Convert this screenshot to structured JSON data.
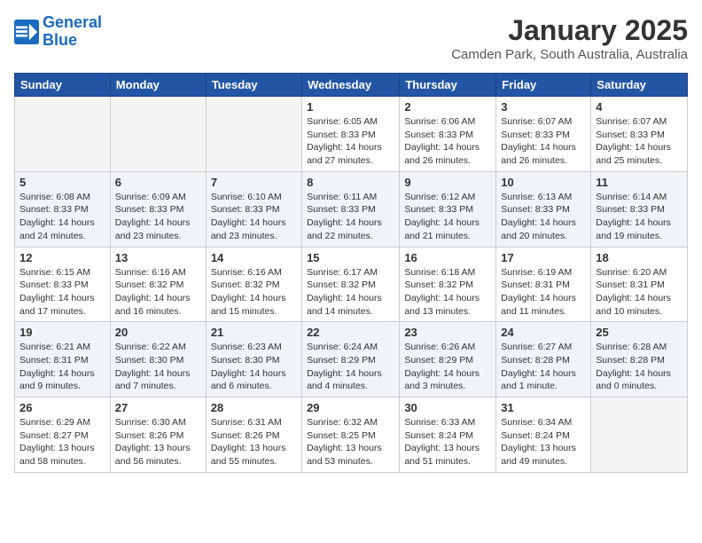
{
  "logo": {
    "line1": "General",
    "line2": "Blue"
  },
  "title": "January 2025",
  "location": "Camden Park, South Australia, Australia",
  "days_of_week": [
    "Sunday",
    "Monday",
    "Tuesday",
    "Wednesday",
    "Thursday",
    "Friday",
    "Saturday"
  ],
  "weeks": [
    [
      {
        "day": "",
        "info": ""
      },
      {
        "day": "",
        "info": ""
      },
      {
        "day": "",
        "info": ""
      },
      {
        "day": "1",
        "info": "Sunrise: 6:05 AM\nSunset: 8:33 PM\nDaylight: 14 hours\nand 27 minutes."
      },
      {
        "day": "2",
        "info": "Sunrise: 6:06 AM\nSunset: 8:33 PM\nDaylight: 14 hours\nand 26 minutes."
      },
      {
        "day": "3",
        "info": "Sunrise: 6:07 AM\nSunset: 8:33 PM\nDaylight: 14 hours\nand 26 minutes."
      },
      {
        "day": "4",
        "info": "Sunrise: 6:07 AM\nSunset: 8:33 PM\nDaylight: 14 hours\nand 25 minutes."
      }
    ],
    [
      {
        "day": "5",
        "info": "Sunrise: 6:08 AM\nSunset: 8:33 PM\nDaylight: 14 hours\nand 24 minutes."
      },
      {
        "day": "6",
        "info": "Sunrise: 6:09 AM\nSunset: 8:33 PM\nDaylight: 14 hours\nand 23 minutes."
      },
      {
        "day": "7",
        "info": "Sunrise: 6:10 AM\nSunset: 8:33 PM\nDaylight: 14 hours\nand 23 minutes."
      },
      {
        "day": "8",
        "info": "Sunrise: 6:11 AM\nSunset: 8:33 PM\nDaylight: 14 hours\nand 22 minutes."
      },
      {
        "day": "9",
        "info": "Sunrise: 6:12 AM\nSunset: 8:33 PM\nDaylight: 14 hours\nand 21 minutes."
      },
      {
        "day": "10",
        "info": "Sunrise: 6:13 AM\nSunset: 8:33 PM\nDaylight: 14 hours\nand 20 minutes."
      },
      {
        "day": "11",
        "info": "Sunrise: 6:14 AM\nSunset: 8:33 PM\nDaylight: 14 hours\nand 19 minutes."
      }
    ],
    [
      {
        "day": "12",
        "info": "Sunrise: 6:15 AM\nSunset: 8:33 PM\nDaylight: 14 hours\nand 17 minutes."
      },
      {
        "day": "13",
        "info": "Sunrise: 6:16 AM\nSunset: 8:32 PM\nDaylight: 14 hours\nand 16 minutes."
      },
      {
        "day": "14",
        "info": "Sunrise: 6:16 AM\nSunset: 8:32 PM\nDaylight: 14 hours\nand 15 minutes."
      },
      {
        "day": "15",
        "info": "Sunrise: 6:17 AM\nSunset: 8:32 PM\nDaylight: 14 hours\nand 14 minutes."
      },
      {
        "day": "16",
        "info": "Sunrise: 6:18 AM\nSunset: 8:32 PM\nDaylight: 14 hours\nand 13 minutes."
      },
      {
        "day": "17",
        "info": "Sunrise: 6:19 AM\nSunset: 8:31 PM\nDaylight: 14 hours\nand 11 minutes."
      },
      {
        "day": "18",
        "info": "Sunrise: 6:20 AM\nSunset: 8:31 PM\nDaylight: 14 hours\nand 10 minutes."
      }
    ],
    [
      {
        "day": "19",
        "info": "Sunrise: 6:21 AM\nSunset: 8:31 PM\nDaylight: 14 hours\nand 9 minutes."
      },
      {
        "day": "20",
        "info": "Sunrise: 6:22 AM\nSunset: 8:30 PM\nDaylight: 14 hours\nand 7 minutes."
      },
      {
        "day": "21",
        "info": "Sunrise: 6:23 AM\nSunset: 8:30 PM\nDaylight: 14 hours\nand 6 minutes."
      },
      {
        "day": "22",
        "info": "Sunrise: 6:24 AM\nSunset: 8:29 PM\nDaylight: 14 hours\nand 4 minutes."
      },
      {
        "day": "23",
        "info": "Sunrise: 6:26 AM\nSunset: 8:29 PM\nDaylight: 14 hours\nand 3 minutes."
      },
      {
        "day": "24",
        "info": "Sunrise: 6:27 AM\nSunset: 8:28 PM\nDaylight: 14 hours\nand 1 minute."
      },
      {
        "day": "25",
        "info": "Sunrise: 6:28 AM\nSunset: 8:28 PM\nDaylight: 14 hours\nand 0 minutes."
      }
    ],
    [
      {
        "day": "26",
        "info": "Sunrise: 6:29 AM\nSunset: 8:27 PM\nDaylight: 13 hours\nand 58 minutes."
      },
      {
        "day": "27",
        "info": "Sunrise: 6:30 AM\nSunset: 8:26 PM\nDaylight: 13 hours\nand 56 minutes."
      },
      {
        "day": "28",
        "info": "Sunrise: 6:31 AM\nSunset: 8:26 PM\nDaylight: 13 hours\nand 55 minutes."
      },
      {
        "day": "29",
        "info": "Sunrise: 6:32 AM\nSunset: 8:25 PM\nDaylight: 13 hours\nand 53 minutes."
      },
      {
        "day": "30",
        "info": "Sunrise: 6:33 AM\nSunset: 8:24 PM\nDaylight: 13 hours\nand 51 minutes."
      },
      {
        "day": "31",
        "info": "Sunrise: 6:34 AM\nSunset: 8:24 PM\nDaylight: 13 hours\nand 49 minutes."
      },
      {
        "day": "",
        "info": ""
      }
    ]
  ]
}
